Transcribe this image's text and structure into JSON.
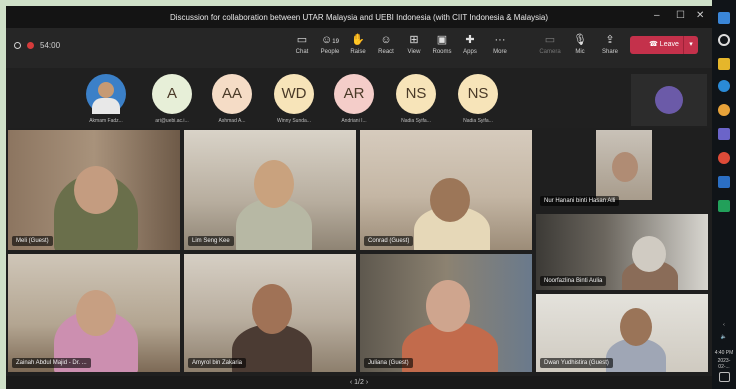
{
  "window": {
    "title": "Discussion for collaboration between UTAR Malaysia and UEBI Indonesia (with CIIT Indonesia & Malaysia)"
  },
  "meeting": {
    "timer": "54:00"
  },
  "toolbar": {
    "buttons": [
      {
        "label": "Chat",
        "icon": "chat-icon"
      },
      {
        "label": "People",
        "icon": "people-icon",
        "count": "19"
      },
      {
        "label": "Raise",
        "icon": "raise-hand-icon"
      },
      {
        "label": "React",
        "icon": "react-icon"
      },
      {
        "label": "View",
        "icon": "view-icon"
      },
      {
        "label": "Rooms",
        "icon": "rooms-icon"
      },
      {
        "label": "Apps",
        "icon": "apps-icon"
      },
      {
        "label": "More",
        "icon": "more-icon"
      },
      {
        "label": "Camera",
        "icon": "camera-icon"
      },
      {
        "label": "Mic",
        "icon": "mic-icon"
      },
      {
        "label": "Share",
        "icon": "share-icon"
      }
    ],
    "leave_label": "Leave"
  },
  "attendees": [
    {
      "initials": "",
      "name": "Akmam Fadz...",
      "color": "#3b80c8"
    },
    {
      "initials": "A",
      "name": "ari@uebi.ac.i...",
      "color": "#e7efd8"
    },
    {
      "initials": "AA",
      "name": "Ashmad A...",
      "color": "#f5dcc6"
    },
    {
      "initials": "WD",
      "name": "Winny Sunda...",
      "color": "#f7e4b9"
    },
    {
      "initials": "AR",
      "name": "Andriani I...",
      "color": "#f4cdc9"
    },
    {
      "initials": "NS",
      "name": "Nadia Syifa...",
      "color": "#f7e4b9"
    },
    {
      "initials": "NS",
      "name": "Nadia Syifa...",
      "color": "#f7e4b9"
    }
  ],
  "participants": [
    {
      "name": "Meli (Guest)"
    },
    {
      "name": "Lim Seng Kee"
    },
    {
      "name": "Conrad (Guest)"
    },
    {
      "name": "Nur Hanani binti Hasan Alli"
    },
    {
      "name": "Noorfazlina Binti Aulia"
    },
    {
      "name": "Zainah Abdul Majid - Dr. ..."
    },
    {
      "name": "Amyrol bin Zakaria"
    },
    {
      "name": "Juliana (Guest)"
    },
    {
      "name": "Dwan Yudhistira (Guest)"
    }
  ],
  "pager": {
    "text": "1/2"
  },
  "taskbar": {
    "time": "4:40 PM",
    "date": "2023-02-..."
  }
}
